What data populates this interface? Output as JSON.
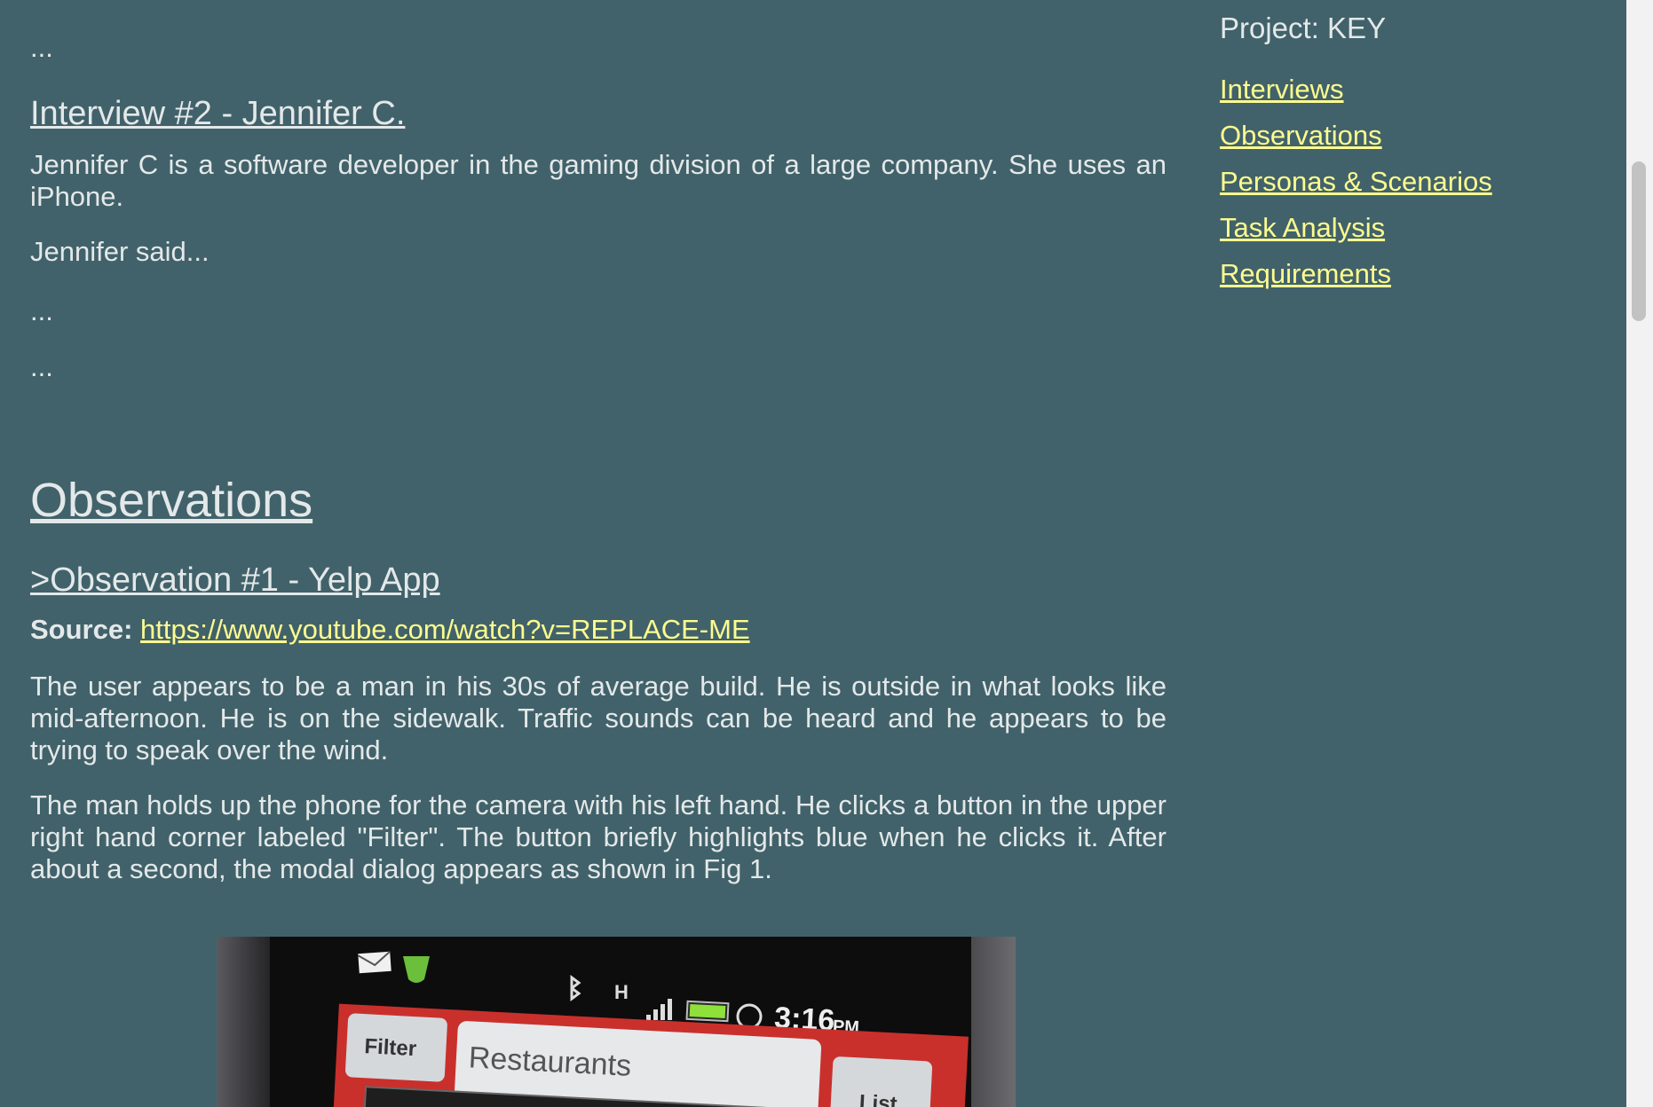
{
  "main": {
    "top_ellipsis": "...",
    "interview2": {
      "title": "Interview #2 - Jennifer C.",
      "intro": "Jennifer C is a software developer in the gaming division of a large company. She uses an iPhone.",
      "said": "Jennifer said...",
      "ellipsis_1": "...",
      "ellipsis_2": "..."
    },
    "observations": {
      "heading": "Observations",
      "obs1": {
        "title": ">Observation #1 - Yelp App",
        "source_label": "Source:",
        "source_url": "https://www.youtube.com/watch?v=REPLACE-ME",
        "para1": "The user appears to be a man in his 30s of average build. He is outside in what looks like mid-afternoon. He is on the sidewalk. Traffic sounds can be heard and he appears to be trying to speak over the wind.",
        "para2": "The man holds up the phone for the camera with his left hand. He clicks a button in the upper right hand corner labeled \"Filter\". The button briefly highlights blue when he clicks it. After about a second, the modal dialog appears as shown in Fig 1."
      }
    },
    "figure": {
      "filter_button": "Filter",
      "search_text": "Restaurants",
      "list_button": "List",
      "clock": "3:16",
      "clock_suffix": "PM",
      "network": "H"
    }
  },
  "sidebar": {
    "title": "Project: KEY",
    "links": [
      "Interviews",
      "Observations",
      "Personas & Scenarios",
      "Task Analysis",
      "Requirements"
    ]
  },
  "colors": {
    "background": "#41626a",
    "text": "#e4e8e9",
    "link": "#fdfb8f"
  }
}
